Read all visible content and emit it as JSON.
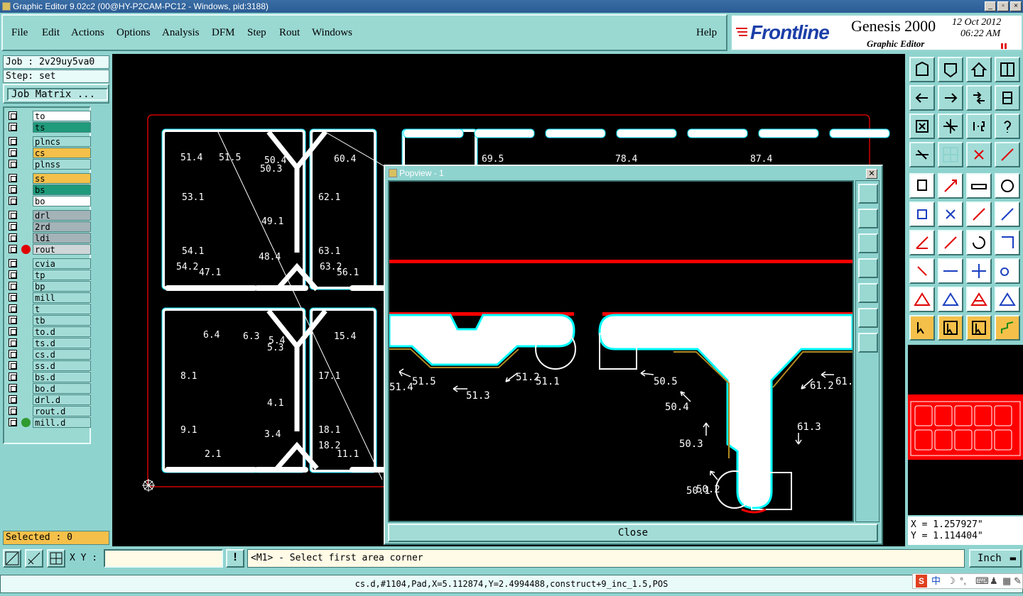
{
  "window": {
    "title": "Graphic Editor 9.02c2 (00@HY-P2CAM-PC12 - Windows, pid:3188)"
  },
  "menu": {
    "items": [
      "File",
      "Edit",
      "Actions",
      "Options",
      "Analysis",
      "DFM",
      "Step",
      "Rout",
      "Windows"
    ],
    "help": "Help"
  },
  "brand": {
    "company": "Frontline",
    "product": "Genesis 2000",
    "subtitle": "Graphic Editor",
    "date": "12 Oct 2012",
    "time": "06:22 AM"
  },
  "job": {
    "job_line": "Job : 2v29uy5va0",
    "step_line": "Step: set",
    "matrix_button": "Job Matrix ..."
  },
  "layers": [
    {
      "name": "to",
      "color": "#ffffff"
    },
    {
      "name": "ts",
      "color": "#1f9a7a"
    },
    {
      "name": "plncs",
      "color": "#a3dcd7"
    },
    {
      "name": "cs",
      "color": "#f5c04a"
    },
    {
      "name": "plnss",
      "color": "#a3dcd7"
    },
    {
      "name": "ss",
      "color": "#f5c04a"
    },
    {
      "name": "bs",
      "color": "#1f9a7a"
    },
    {
      "name": "bo",
      "color": "#ffffff"
    },
    {
      "name": "drl",
      "color": "#a3b3b8"
    },
    {
      "name": "2rd",
      "color": "#a3b3b8"
    },
    {
      "name": "ldi",
      "color": "#a3b3b8"
    },
    {
      "name": "rout",
      "color": "#cfd6d8",
      "dot": "#e00000"
    },
    {
      "name": "cvia",
      "color": "#a3dcd7"
    },
    {
      "name": "tp",
      "color": "#a3dcd7"
    },
    {
      "name": "bp",
      "color": "#a3dcd7"
    },
    {
      "name": "mill",
      "color": "#a3dcd7"
    },
    {
      "name": "t",
      "color": "#a3dcd7"
    },
    {
      "name": "tb",
      "color": "#a3dcd7"
    },
    {
      "name": "to.d",
      "color": "#a3dcd7"
    },
    {
      "name": "ts.d",
      "color": "#a3dcd7"
    },
    {
      "name": "cs.d",
      "color": "#a3dcd7"
    },
    {
      "name": "ss.d",
      "color": "#a3dcd7"
    },
    {
      "name": "bs.d",
      "color": "#a3dcd7"
    },
    {
      "name": "bo.d",
      "color": "#a3dcd7"
    },
    {
      "name": "drl.d",
      "color": "#a3dcd7"
    },
    {
      "name": "rout.d",
      "color": "#a3dcd7"
    },
    {
      "name": "mill.d",
      "color": "#a3dcd7",
      "dot": "#2f9a2f"
    }
  ],
  "selected": "Selected : 0",
  "popview": {
    "title": "Popview - 1",
    "close": "Close",
    "labels": [
      "51.4",
      "51.5",
      "51.3",
      "51.2",
      "51.1",
      "50.5",
      "50.4",
      "50.3",
      "50.2",
      "50.1",
      "61.2",
      "61.3",
      "61."
    ]
  },
  "canvas_labels": [
    "53.1",
    "49.1",
    "62.1",
    "54.1",
    "54.2",
    "47.1",
    "48.4",
    "63.1",
    "63.2",
    "56.1",
    "8.1",
    "4.1",
    "17.1",
    "9.1",
    "2.1",
    "3.4",
    "18.1",
    "18.2",
    "11.1",
    "51.4",
    "51.5",
    "60.4",
    "69.5",
    "78.4",
    "87.4",
    "6.4",
    "6.3",
    "15.4",
    "5.3",
    "50.3",
    "50.4",
    "5.4"
  ],
  "coords": {
    "x": "X = 1.257927\"",
    "y": "Y = 1.114404\""
  },
  "bottom": {
    "xy_label": "X Y :",
    "xy_value": "",
    "prompt": "<M1> - Select first area corner",
    "units": "Inch"
  },
  "status": "cs.d,#1104,Pad,X=5.112874,Y=2.4994488,construct+9_inc_1.5,POS",
  "ime": {
    "label": "中"
  },
  "colors": {
    "accent": "#8fd3cf",
    "rout": "#e00000",
    "board_white": "#ffffff",
    "outline_cyan": "#00ffff"
  }
}
